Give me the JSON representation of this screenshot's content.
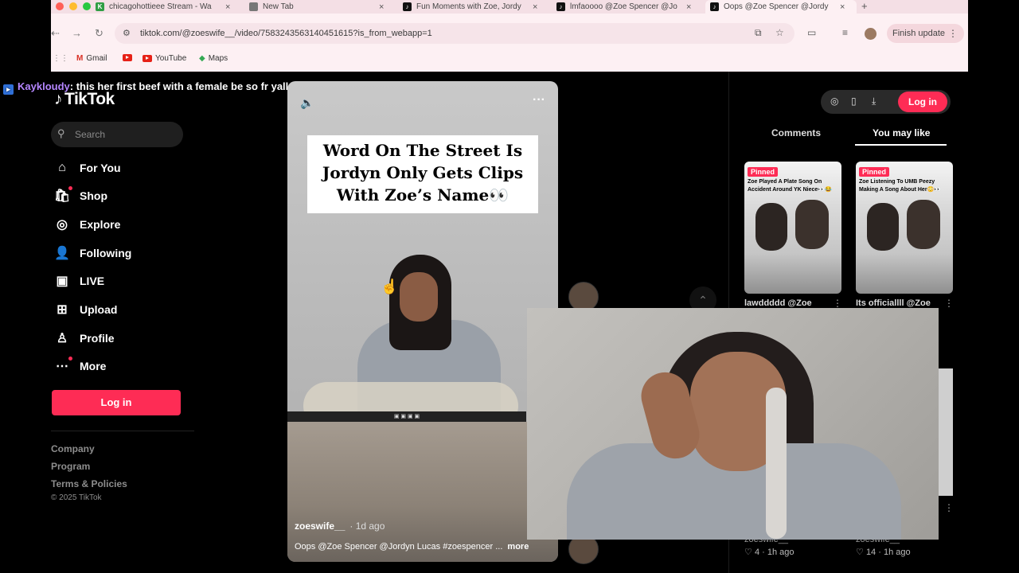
{
  "browser": {
    "tabs": [
      {
        "title": "chicagohottieee Stream - Wa",
        "fav_color": "#2f9e44",
        "fav_letter": "K",
        "active": false
      },
      {
        "title": "New Tab",
        "fav_color": "#777777",
        "fav_letter": "",
        "active": false
      },
      {
        "title": "Fun Moments with Zoe, Jordy",
        "fav_color": "#111111",
        "fav_letter": "♪",
        "active": false
      },
      {
        "title": "lmfaoooo @Zoe Spencer @Jo",
        "fav_color": "#111111",
        "fav_letter": "♪",
        "active": false
      },
      {
        "title": "Oops @Zoe Spencer @Jordy",
        "fav_color": "#111111",
        "fav_letter": "♪",
        "active": true
      }
    ],
    "url": "tiktok.com/@zoeswife__/video/7583243563140451615?is_from_webapp=1",
    "finish_update": "Finish update",
    "bookmarks": [
      "Gmail",
      "YouTube",
      "Maps"
    ]
  },
  "chat": {
    "username": "Kaykloudy",
    "message": ": this her first beef with a female be so fr yall"
  },
  "tiktok": {
    "logo": "TikTok",
    "search_placeholder": "Search",
    "nav": [
      "For You",
      "Shop",
      "Explore",
      "Following",
      "LIVE",
      "Upload",
      "Profile",
      "More"
    ],
    "login": "Log in",
    "footer": [
      "Company",
      "Program",
      "Terms & Policies"
    ],
    "copyright": "© 2025 TikTok"
  },
  "video": {
    "caption_lines": [
      "Word On The Street Is",
      "Jordyn Only Gets Clips",
      "With Zoe’s Name👀"
    ],
    "author": "zoeswife__",
    "age": "· 1d ago",
    "description": "Oops @Zoe Spencer @Jordyn Lucas #zoespencer ...",
    "more": "more"
  },
  "right_panel": {
    "login": "Log in",
    "tabs": [
      "Comments",
      "You may like"
    ],
    "active_tab": "You may like",
    "cards": [
      {
        "pinned": "Pinned",
        "caption": "Zoe Played A Plate Song On Accident Around YK Niece👀😂",
        "label": "lawddddd @Zoe"
      },
      {
        "pinned": "Pinned",
        "caption": "Zoe Listening To UMB Peezy Making A Song About Her😳👀",
        "label": "Its officiallll @Zoe"
      }
    ],
    "bottom_cards": [
      {
        "author": "zoeswife__",
        "likes": "4",
        "age": "· 1h ago"
      },
      {
        "author": "zoeswife__",
        "likes": "14",
        "age": "· 1h ago"
      }
    ]
  }
}
